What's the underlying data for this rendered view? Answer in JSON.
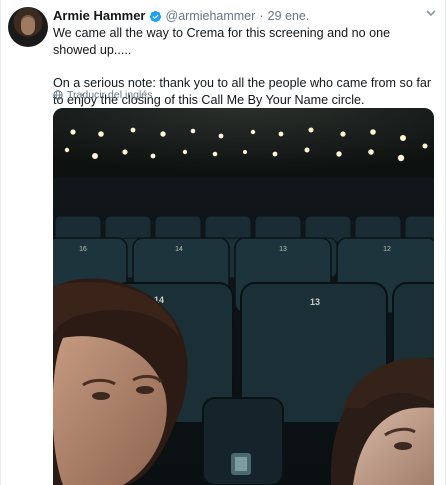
{
  "tweet": {
    "author_name": "Armie Hammer",
    "handle": "@armiehammer",
    "separator": "·",
    "date": "29 ene.",
    "paragraph_1": "We came all the way to Crema for this screening and no one showed up.....",
    "paragraph_2": "On a serious note: thank you to all the people who came from so far to enjoy the closing of this  Call Me By Your Name circle.",
    "translate_label": "Traducir del inglés",
    "seat_numbers": [
      "16",
      "14",
      "13",
      "12",
      "14",
      "13"
    ]
  },
  "icons": {
    "verified": "verified-badge-icon",
    "caret": "chevron-down-icon",
    "globe": "globe-icon"
  },
  "colors": {
    "verified_blue": "#1da1f2",
    "muted": "#657786",
    "text": "#14171a"
  }
}
